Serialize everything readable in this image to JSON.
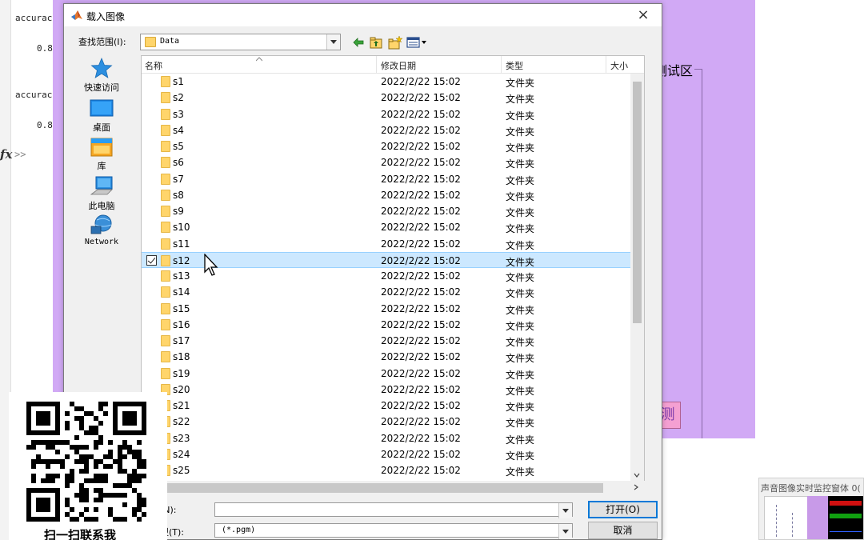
{
  "background": {
    "command_window": {
      "lines": [
        "accurac",
        "0.8",
        "accurac",
        "0.8"
      ],
      "prompt": ">>"
    },
    "gui": {
      "panel_title": "测试区",
      "button_fragment": "测"
    },
    "thumbnail": {
      "title": "声音图像实时监控窗体 0("
    }
  },
  "dialog": {
    "title": "载入图像",
    "close_glyph": "×",
    "look_in_label": "查找范围(I):",
    "look_in_value": "Data",
    "places": [
      {
        "label": "快速访问",
        "icon": "star-icon"
      },
      {
        "label": "桌面",
        "icon": "desktop-icon"
      },
      {
        "label": "库",
        "icon": "library-icon"
      },
      {
        "label": "此电脑",
        "icon": "computer-icon"
      },
      {
        "label": "Network",
        "icon": "network-icon"
      }
    ],
    "columns": {
      "name": "名称",
      "date": "修改日期",
      "type": "类型",
      "size": "大小"
    },
    "files": [
      {
        "name": "s1",
        "date": "2022/2/22 15:02",
        "type": "文件夹"
      },
      {
        "name": "s2",
        "date": "2022/2/22 15:02",
        "type": "文件夹"
      },
      {
        "name": "s3",
        "date": "2022/2/22 15:02",
        "type": "文件夹"
      },
      {
        "name": "s4",
        "date": "2022/2/22 15:02",
        "type": "文件夹"
      },
      {
        "name": "s5",
        "date": "2022/2/22 15:02",
        "type": "文件夹"
      },
      {
        "name": "s6",
        "date": "2022/2/22 15:02",
        "type": "文件夹"
      },
      {
        "name": "s7",
        "date": "2022/2/22 15:02",
        "type": "文件夹"
      },
      {
        "name": "s8",
        "date": "2022/2/22 15:02",
        "type": "文件夹"
      },
      {
        "name": "s9",
        "date": "2022/2/22 15:02",
        "type": "文件夹"
      },
      {
        "name": "s10",
        "date": "2022/2/22 15:02",
        "type": "文件夹"
      },
      {
        "name": "s11",
        "date": "2022/2/22 15:02",
        "type": "文件夹"
      },
      {
        "name": "s12",
        "date": "2022/2/22 15:02",
        "type": "文件夹",
        "selected": true
      },
      {
        "name": "s13",
        "date": "2022/2/22 15:02",
        "type": "文件夹"
      },
      {
        "name": "s14",
        "date": "2022/2/22 15:02",
        "type": "文件夹"
      },
      {
        "name": "s15",
        "date": "2022/2/22 15:02",
        "type": "文件夹"
      },
      {
        "name": "s16",
        "date": "2022/2/22 15:02",
        "type": "文件夹"
      },
      {
        "name": "s17",
        "date": "2022/2/22 15:02",
        "type": "文件夹"
      },
      {
        "name": "s18",
        "date": "2022/2/22 15:02",
        "type": "文件夹"
      },
      {
        "name": "s19",
        "date": "2022/2/22 15:02",
        "type": "文件夹"
      },
      {
        "name": "s20",
        "date": "2022/2/22 15:02",
        "type": "文件夹"
      },
      {
        "name": "s21",
        "date": "2022/2/22 15:02",
        "type": "文件夹"
      },
      {
        "name": "s22",
        "date": "2022/2/22 15:02",
        "type": "文件夹"
      },
      {
        "name": "s23",
        "date": "2022/2/22 15:02",
        "type": "文件夹"
      },
      {
        "name": "s24",
        "date": "2022/2/22 15:02",
        "type": "文件夹"
      },
      {
        "name": "s25",
        "date": "2022/2/22 15:02",
        "type": "文件夹"
      }
    ],
    "file_name_label": "(N):",
    "file_name_value": "",
    "file_type_label": "型(T):",
    "file_type_value": "(*.pgm)",
    "open_button": "打开(O)",
    "cancel_button": "取消"
  },
  "overlay": {
    "qr_caption": "扫一扫联系我"
  },
  "colors": {
    "gui_background": "#d1a9f5",
    "selection": "#cce8ff",
    "folder": "#ffd56b"
  }
}
